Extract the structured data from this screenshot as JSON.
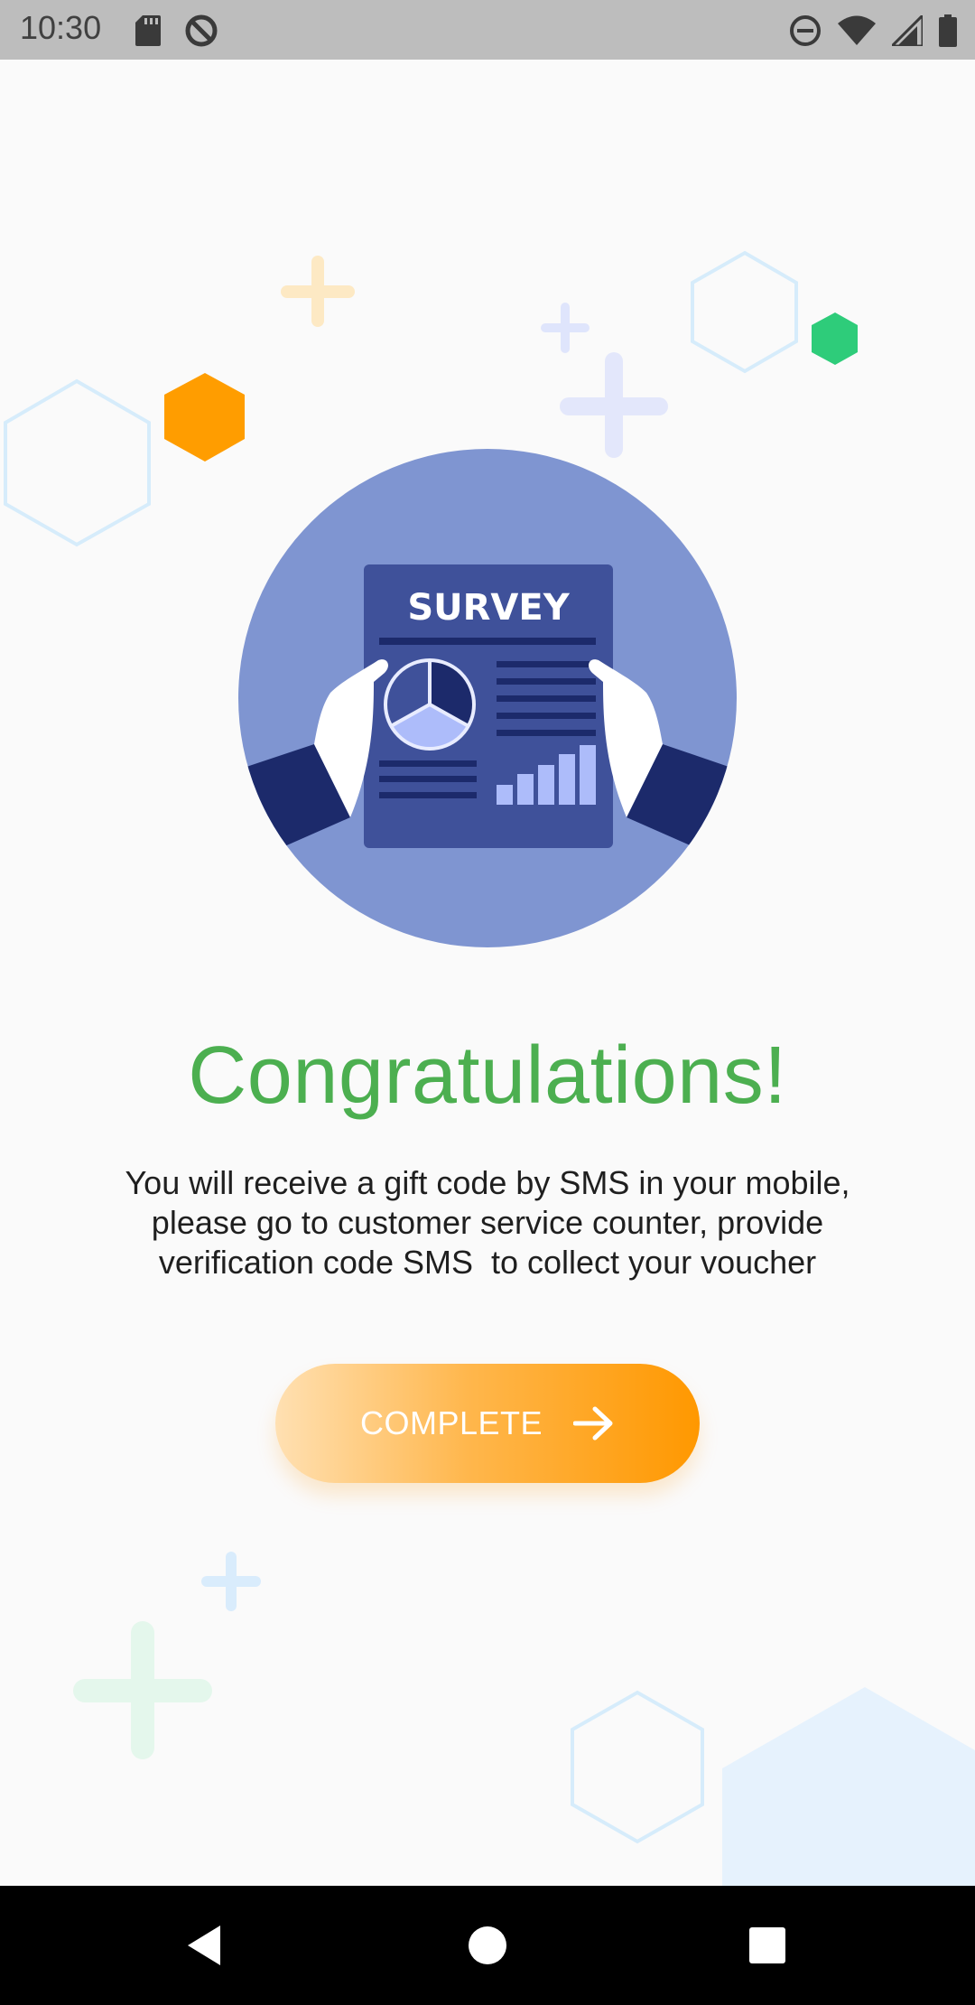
{
  "status_bar": {
    "time": "10:30",
    "left_icons": [
      "sd-card-icon",
      "sync-disabled-icon"
    ],
    "right_icons": [
      "do-not-disturb-icon",
      "wifi-icon",
      "signal-icon",
      "battery-icon"
    ]
  },
  "hero": {
    "document_title": "SURVEY",
    "illustration": "survey-document-held-by-hands"
  },
  "main": {
    "title": "Congratulations!",
    "message_lines": [
      "You will receive a gift code by SMS in your mobile,",
      "please go to customer service counter, provide",
      "verification code SMS  to collect your voucher"
    ]
  },
  "button": {
    "label": "COMPLETE",
    "icon": "arrow-right-icon"
  },
  "nav_bar": {
    "buttons": [
      "back-icon",
      "home-icon",
      "recents-icon"
    ]
  },
  "colors": {
    "title_green": "#4caf50",
    "button_orange": "#ff9800",
    "hero_circle": "#7f95d1",
    "document": "#3f51a0"
  }
}
